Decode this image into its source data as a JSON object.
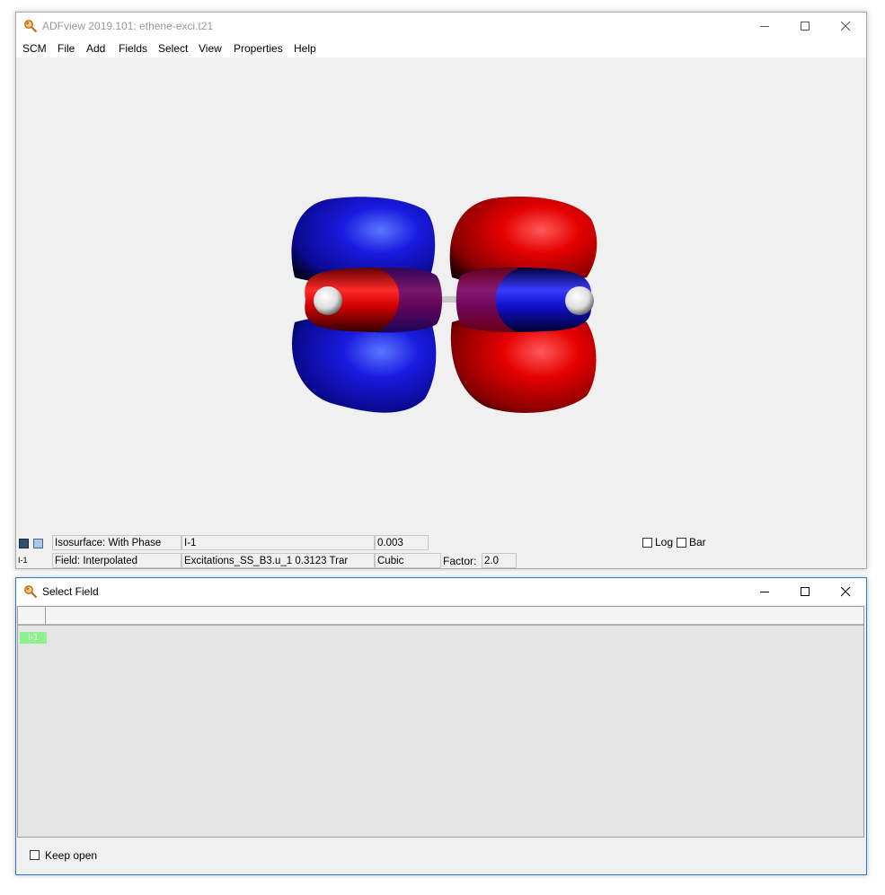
{
  "main_window": {
    "title": "ADFview 2019.101: ethene-exci.t21",
    "menu": [
      "SCM",
      "File",
      "Add",
      "Fields",
      "Select",
      "View",
      "Properties",
      "Help"
    ],
    "status": {
      "row1": {
        "surface_type": "Isosurface: With Phase",
        "field_name": "I-1",
        "iso_value": "0.003",
        "log_label": "Log",
        "bar_label": "Bar"
      },
      "row2": {
        "field_tag": "I-1",
        "field_mode": "Field: Interpolated",
        "field_source": "Excitations_SS_B3.u_1   0.3123 Trar",
        "interpolation": "Cubic",
        "factor_label": "Factor:",
        "factor_value": "2.0"
      }
    }
  },
  "select_field_window": {
    "title": "Select Field",
    "fields": [
      "I-1"
    ],
    "keep_open_label": "Keep open"
  },
  "colors": {
    "positive_lobe": "#e00000",
    "negative_lobe": "#0a0ad8",
    "selected_row": "#8ef08e"
  },
  "icons": [
    "magnifier-icon",
    "minimize-icon",
    "maximize-icon",
    "close-icon"
  ]
}
